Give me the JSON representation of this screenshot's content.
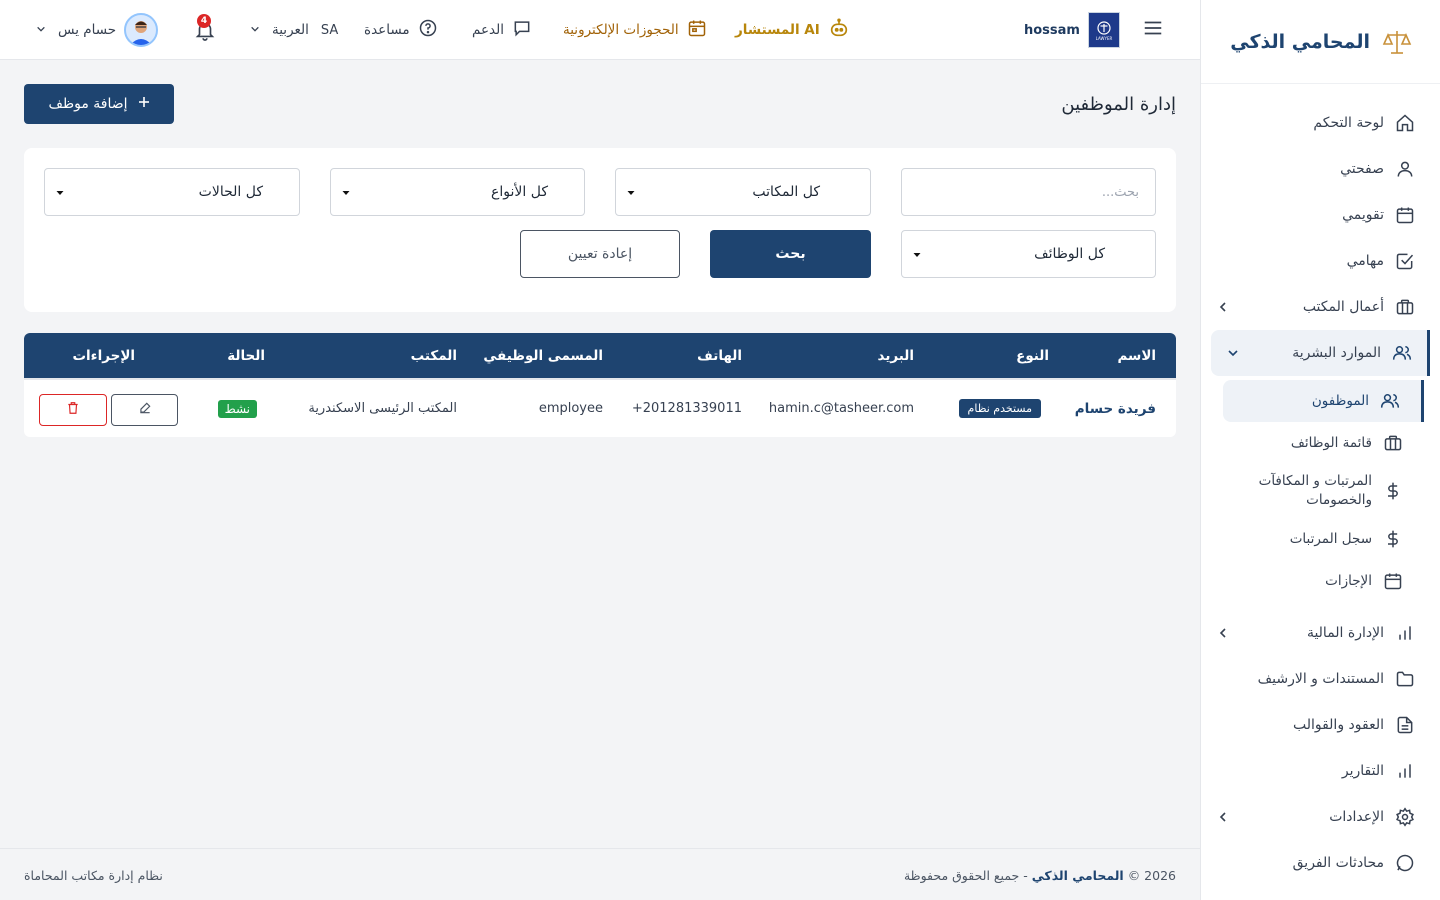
{
  "brand": {
    "name": "المحامي الذكي"
  },
  "topbar": {
    "user_name": "حسام يس",
    "notification_count": "4",
    "language": "العربية",
    "country_code": "SA",
    "help": "مساعدة",
    "support": "الدعم",
    "bookings": "الحجوزات الإلكترونية",
    "ai_advisor": "المستشار AI",
    "office_name": "hossam",
    "logo_text": "LAWYER"
  },
  "sidebar": {
    "items": [
      {
        "label": "لوحة التحكم",
        "icon": "home-icon"
      },
      {
        "label": "صفحتي",
        "icon": "user-icon"
      },
      {
        "label": "تقويمي",
        "icon": "calendar-icon"
      },
      {
        "label": "مهامي",
        "icon": "check-square-icon"
      },
      {
        "label": "أعمال المكتب",
        "icon": "briefcase-icon"
      },
      {
        "label": "الموارد البشرية",
        "icon": "users-icon"
      },
      {
        "label": "الإدارة المالية",
        "icon": "bar-chart-icon"
      },
      {
        "label": "المستندات و الارشيف",
        "icon": "folder-icon"
      },
      {
        "label": "العقود والقوالب",
        "icon": "file-text-icon"
      },
      {
        "label": "التقارير",
        "icon": "bar-chart-icon"
      },
      {
        "label": "الإعدادات",
        "icon": "gear-icon"
      },
      {
        "label": "محادثات الفريق",
        "icon": "chat-icon"
      }
    ],
    "hr_sub": [
      {
        "label": "الموظفون"
      },
      {
        "label": "قائمة الوظائف"
      },
      {
        "label": "المرتبات و المكافآت والخصومات"
      },
      {
        "label": "سجل المرتبات"
      },
      {
        "label": "الإجازات"
      }
    ]
  },
  "page": {
    "title": "إدارة الموظفين",
    "add_button": "إضافة موظف"
  },
  "filters": {
    "search_placeholder": "بحث...",
    "offices": "كل المكاتب",
    "types": "كل الأنواع",
    "statuses": "كل الحالات",
    "jobs": "كل الوظائف",
    "search_button": "بحث",
    "reset_button": "إعادة تعيين"
  },
  "table": {
    "headers": {
      "name": "الاسم",
      "type": "النوع",
      "email": "البريد",
      "phone": "الهاتف",
      "job_title": "المسمى الوظيفي",
      "office": "المكتب",
      "status": "الحالة",
      "actions": "الإجراءات"
    },
    "rows": [
      {
        "name": "فريدة حسام",
        "type": "مستخدم نظام",
        "email": "hamin.c@tasheer.com",
        "phone": "+201281339011",
        "job_title": "employee",
        "office": "المكتب الرئيسى الاسكندرية",
        "status": "نشط"
      }
    ]
  },
  "footer": {
    "copyright_prefix": "© 2026",
    "copyright_brand": "المحامي الذكي",
    "copyright_suffix": "- جميع الحقوق محفوظة",
    "system_name": "نظام إدارة مكاتب المحاماة"
  },
  "colors": {
    "primary": "#1e4470",
    "accent": "#b8860b",
    "success": "#22a04b",
    "danger": "#dc2626"
  }
}
